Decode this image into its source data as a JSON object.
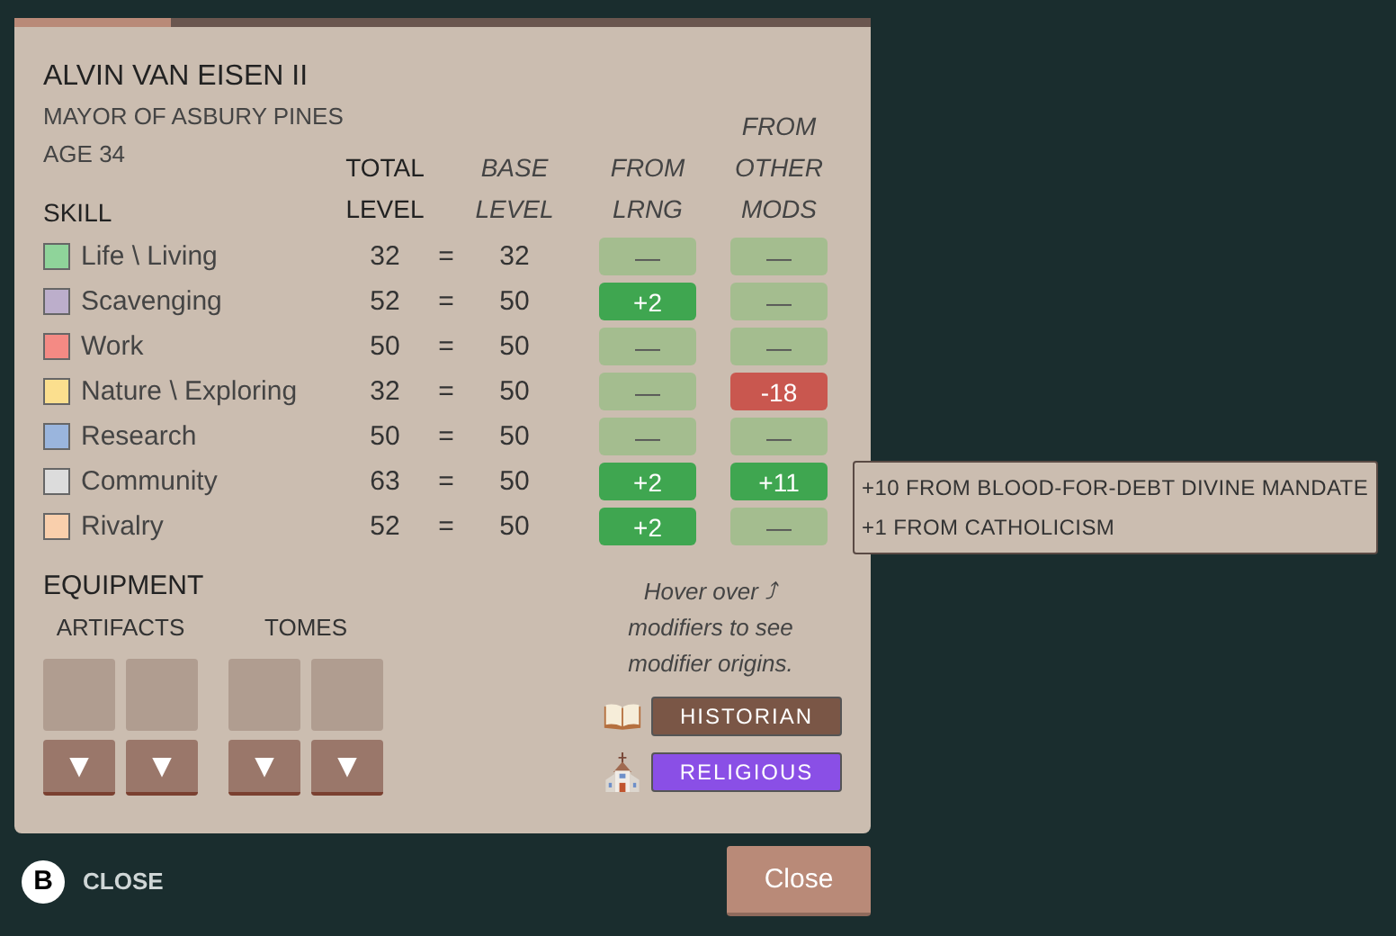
{
  "character": {
    "name": "ALVIN VAN EISEN II",
    "role": "MAYOR OF ASBURY PINES",
    "age": "AGE 34"
  },
  "table": {
    "skill_header": "SKILL",
    "columns": [
      {
        "lines": [
          "TOTAL",
          "LEVEL"
        ],
        "italic": false
      },
      {
        "lines": [
          "BASE",
          "LEVEL"
        ],
        "italic": true
      },
      {
        "lines": [
          "FROM",
          "LRNG"
        ],
        "italic": true
      },
      {
        "lines": [
          "FROM",
          "OTHER",
          "MODS"
        ],
        "italic": true
      }
    ],
    "rows": [
      {
        "name": "Life \\ Living",
        "color": "#8fd49a",
        "total": "32",
        "eq": "=",
        "base": "32",
        "from_lrng": {
          "text": "—",
          "kind": "none"
        },
        "from_other": {
          "text": "—",
          "kind": "none"
        }
      },
      {
        "name": "Scavenging",
        "color": "#bcaecb",
        "total": "52",
        "eq": "=",
        "base": "50",
        "from_lrng": {
          "text": "+2",
          "kind": "bonus"
        },
        "from_other": {
          "text": "—",
          "kind": "none"
        }
      },
      {
        "name": "Work",
        "color": "#f48a84",
        "total": "50",
        "eq": "=",
        "base": "50",
        "from_lrng": {
          "text": "—",
          "kind": "none"
        },
        "from_other": {
          "text": "—",
          "kind": "none"
        }
      },
      {
        "name": "Nature \\ Exploring",
        "color": "#fbdf8e",
        "total": "32",
        "eq": "=",
        "base": "50",
        "from_lrng": {
          "text": "—",
          "kind": "none"
        },
        "from_other": {
          "text": "-18",
          "kind": "penalty"
        }
      },
      {
        "name": "Research",
        "color": "#9ab5dd",
        "total": "50",
        "eq": "=",
        "base": "50",
        "from_lrng": {
          "text": "—",
          "kind": "none"
        },
        "from_other": {
          "text": "—",
          "kind": "none"
        }
      },
      {
        "name": "Community",
        "color": "#dcdcdc",
        "total": "63",
        "eq": "=",
        "base": "50",
        "from_lrng": {
          "text": "+2",
          "kind": "bonus"
        },
        "from_other": {
          "text": "+11",
          "kind": "bonus"
        }
      },
      {
        "name": "Rivalry",
        "color": "#f9cfac",
        "total": "52",
        "eq": "=",
        "base": "50",
        "from_lrng": {
          "text": "+2",
          "kind": "bonus"
        },
        "from_other": {
          "text": "—",
          "kind": "none"
        }
      }
    ]
  },
  "tooltip": {
    "lines": [
      "+10 FROM BLOOD-FOR-DEBT DIVINE MANDATE",
      "+1 FROM CATHOLICISM"
    ]
  },
  "equipment": {
    "title": "EQUIPMENT",
    "groups": [
      {
        "label": "ARTIFACTS",
        "slots": [
          {
            "button": "▼"
          },
          {
            "button": "▼"
          }
        ]
      },
      {
        "label": "TOMES",
        "slots": [
          {
            "button": "▼"
          },
          {
            "button": "▼"
          }
        ]
      }
    ]
  },
  "hint": "Hover over ⤴ modifiers to see modifier origins.",
  "traits": [
    {
      "label": "HISTORIAN",
      "color": "#7a5646",
      "kind": "book"
    },
    {
      "label": "RELIGIOUS",
      "color": "#8a4fe6",
      "kind": "church"
    }
  ],
  "footer": {
    "key": "B",
    "hint": "CLOSE",
    "button": "Close"
  }
}
